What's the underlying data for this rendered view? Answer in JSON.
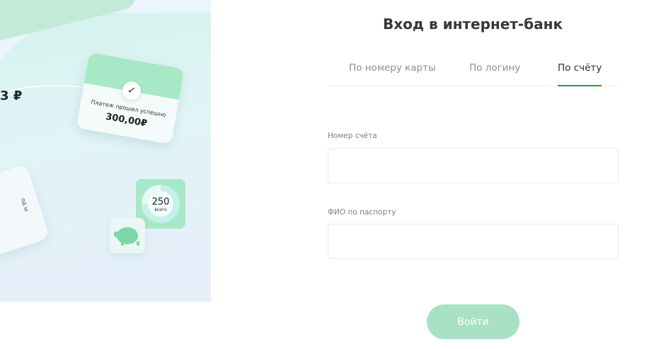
{
  "illustration": {
    "amount_left": "3 ₽",
    "payment_card": {
      "check_icon": "checkmark-icon",
      "message": "Платеж прошел успешно",
      "amount": "300,00₽"
    },
    "side_card_text": "од\nы",
    "stat": {
      "value": "250",
      "label": "всего"
    },
    "piggy_icon": "piggy-bank-icon"
  },
  "login": {
    "title": "Вход в интернет-банк",
    "tabs": [
      {
        "label": "По номеру карты",
        "active": false
      },
      {
        "label": "По логину",
        "active": false
      },
      {
        "label": "По счёту",
        "active": true
      }
    ],
    "fields": [
      {
        "label": "Номер счёта",
        "value": "",
        "placeholder": ""
      },
      {
        "label": "ФИО по паспорту",
        "value": "",
        "placeholder": ""
      }
    ],
    "submit_label": "Войти"
  },
  "colors": {
    "accent_green": "#21a038",
    "button_disabled": "#a9e1c4",
    "card_band": "#a7e8c6"
  }
}
